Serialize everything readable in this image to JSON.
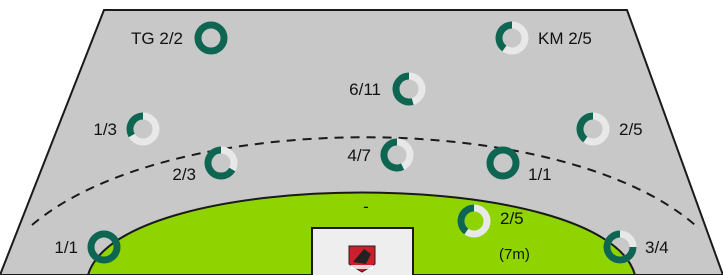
{
  "colors": {
    "court_gray": "#c8c8c8",
    "court_border": "#1a1a1a",
    "six_meter_zone": "#8fd400",
    "ring_made": "#0e6652",
    "ring_missed": "#e8e8e8",
    "goal_box": "#eeeeee"
  },
  "goal": {
    "label": "-",
    "logo": "team-logo"
  },
  "shots": [
    {
      "id": "tg",
      "label": "TG 2/2",
      "made": 2,
      "attempts": 2
    },
    {
      "id": "km",
      "label": "KM 2/5",
      "made": 2,
      "attempts": 5
    },
    {
      "id": "center-far",
      "label": "6/11",
      "made": 6,
      "attempts": 11
    },
    {
      "id": "left-back",
      "label": "1/3",
      "made": 1,
      "attempts": 3
    },
    {
      "id": "right-back",
      "label": "2/5",
      "made": 2,
      "attempts": 5
    },
    {
      "id": "left-nine",
      "label": "2/3",
      "made": 2,
      "attempts": 3
    },
    {
      "id": "center-nine",
      "label": "4/7",
      "made": 4,
      "attempts": 7
    },
    {
      "id": "right-nine",
      "label": "1/1",
      "made": 1,
      "attempts": 1
    },
    {
      "id": "left-wing",
      "label": "1/1",
      "made": 1,
      "attempts": 1
    },
    {
      "id": "penalty",
      "label": "2/5",
      "sublabel": "(7m)",
      "made": 2,
      "attempts": 5
    },
    {
      "id": "right-wing",
      "label": "3/4",
      "made": 3,
      "attempts": 4
    }
  ]
}
